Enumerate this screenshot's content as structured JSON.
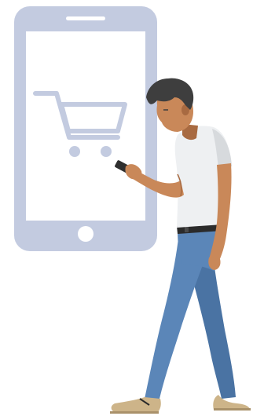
{
  "illustration": {
    "phone_icon": "smartphone-icon",
    "cart_icon": "shopping-cart-icon",
    "subject": "person-using-phone"
  },
  "colors": {
    "phone_frame": "#c3cbe0",
    "phone_screen": "#ffffff",
    "skin": "#c98859",
    "skin_shadow": "#a86a41",
    "hair": "#3e3e3e",
    "shirt": "#eef0f2",
    "shirt_shadow": "#d7dadd",
    "jeans": "#5b86b8",
    "jeans_dark": "#4a73a3",
    "belt": "#2b2b2b",
    "shoe": "#cdb489",
    "shoe_sole": "#a9916a",
    "handset": "#2e2e2e"
  }
}
